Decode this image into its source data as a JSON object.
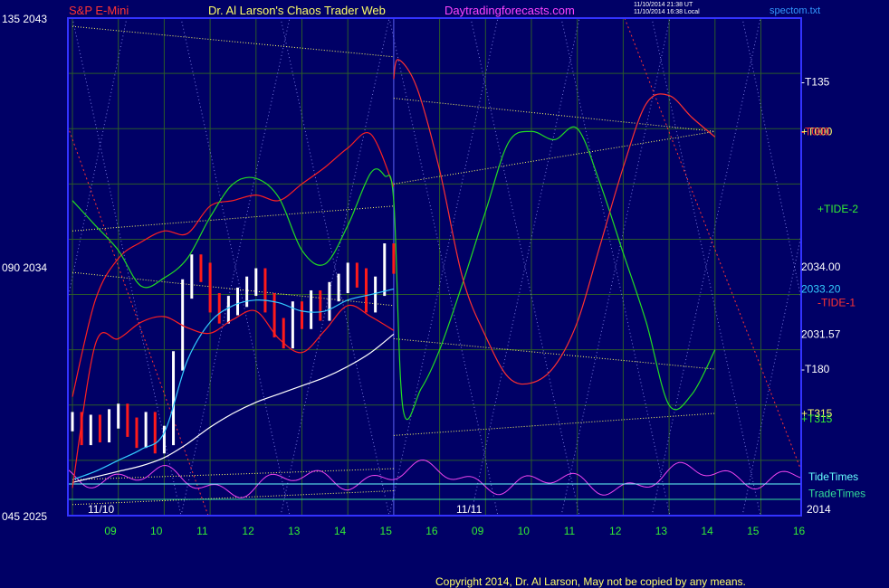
{
  "header": {
    "symbol": "S&P E-Mini",
    "title": "Dr. Al Larson's Chaos Trader Web",
    "site": "Daytradingforecasts.com",
    "time_utc": "11/10/2014 21:38 UT",
    "time_local": "11/10/2014 16:38 Local",
    "filename": "spectom.txt"
  },
  "footer": {
    "copyright": "Copyright 2014, Dr. Al Larson, May not be copied by any means."
  },
  "colors": {
    "background": "#000066",
    "plot_border": "#3333ff",
    "grid": "#2b5a2b",
    "price_up": "#ffffff",
    "price_down": "#ff1a1a",
    "avg_fast": "#33ccff",
    "avg_slow": "#ffffff",
    "band": "#ff2020",
    "tide_plus": "#22dd22",
    "tide_minus": "#ff3030",
    "channel": "#ffff66",
    "tide_times": "#66ffff",
    "trade_times": "#33dd99",
    "oscillator": "#ee44ee",
    "lattice": "#9999ff"
  },
  "chart_data": {
    "type": "line",
    "title": "S&P E-Mini",
    "ylim": [
      2025,
      2043
    ],
    "grid": true,
    "left_axis_labels": [
      {
        "angle": "135",
        "price": "2043"
      },
      {
        "angle": "090",
        "price": "2034"
      },
      {
        "angle": "045",
        "price": "2025"
      }
    ],
    "x_tick_labels": [
      "09",
      "10",
      "11",
      "12",
      "13",
      "14",
      "15",
      "16",
      "09",
      "10",
      "11",
      "12",
      "13",
      "14",
      "15",
      "16"
    ],
    "date_labels": [
      "11/10",
      "11/11"
    ],
    "year_label": "2014",
    "hours_per_day": 7,
    "line_labels": [
      {
        "text": "-T135",
        "price": 2040.7
      },
      {
        "text": "+T000",
        "price": 2038.9
      },
      {
        "text": "-T000",
        "price": 2038.9
      },
      {
        "text": "+TIDE-2",
        "price": 2036.1
      },
      {
        "text": "2034.00",
        "price": 2034.0
      },
      {
        "text": "2033.20",
        "price": 2033.2
      },
      {
        "text": "-TIDE-1",
        "price": 2032.7
      },
      {
        "text": "2031.57",
        "price": 2031.57
      },
      {
        "text": "-T180",
        "price": 2030.3
      },
      {
        "text": "+T315",
        "price": 2028.7
      },
      {
        "text": "+T315",
        "price": 2028.5
      },
      {
        "text": "TideTimes",
        "price": 2026.4
      },
      {
        "text": "TradeTimes",
        "price": 2025.8
      }
    ],
    "series": [
      {
        "name": "Price",
        "kind": "bars",
        "x": [
          0,
          0.2,
          0.4,
          0.6,
          0.8,
          1.0,
          1.2,
          1.4,
          1.6,
          1.8,
          2.0,
          2.2,
          2.4,
          2.6,
          2.8,
          3.0,
          3.2,
          3.4,
          3.6,
          3.8,
          4.0,
          4.2,
          4.4,
          4.6,
          4.8,
          5.0,
          5.2,
          5.4,
          5.6,
          5.8,
          6.0,
          6.2,
          6.4,
          6.6,
          6.8,
          7.0
        ],
        "values": [
          2028.4,
          2027.9,
          2028.3,
          2028.0,
          2028.5,
          2028.7,
          2028.2,
          2027.8,
          2028.4,
          2027.6,
          2027.9,
          2030.6,
          2033.2,
          2034.1,
          2033.8,
          2032.7,
          2032.3,
          2032.6,
          2032.9,
          2033.3,
          2033.6,
          2032.7,
          2031.8,
          2031.4,
          2032.4,
          2032.1,
          2032.8,
          2032.4,
          2033.1,
          2033.4,
          2033.8,
          2033.6,
          2032.7,
          2033.3,
          2034.5,
          2034.1
        ]
      },
      {
        "name": "Fast average",
        "x": [
          0,
          0.5,
          1,
          1.5,
          2,
          2.5,
          3,
          3.5,
          4,
          4.5,
          5,
          5.5,
          6,
          6.5,
          7
        ],
        "values": [
          2026.3,
          2026.6,
          2027.0,
          2027.4,
          2028.0,
          2030.6,
          2032.0,
          2032.6,
          2032.8,
          2032.7,
          2032.4,
          2032.4,
          2032.8,
          2033.0,
          2033.2
        ]
      },
      {
        "name": "Slow average",
        "x": [
          0,
          0.5,
          1,
          1.5,
          2,
          2.5,
          3,
          3.5,
          4,
          4.5,
          5,
          5.5,
          6,
          6.5,
          7
        ],
        "values": [
          2026.2,
          2026.4,
          2026.6,
          2026.8,
          2027.1,
          2027.6,
          2028.2,
          2028.7,
          2029.1,
          2029.4,
          2029.7,
          2030.0,
          2030.4,
          2030.9,
          2031.57
        ]
      },
      {
        "name": "Upper band",
        "x": [
          0,
          0.5,
          1,
          1.5,
          2,
          2.5,
          3,
          3.5,
          4,
          4.5,
          5,
          5.5,
          6,
          6.5,
          7
        ],
        "values": [
          2029.3,
          2032.8,
          2034.3,
          2034.9,
          2035.3,
          2035.2,
          2036.2,
          2036.4,
          2036.6,
          2036.4,
          2037.0,
          2037.6,
          2038.3,
          2038.8,
          2036.9
        ]
      },
      {
        "name": "Lower band",
        "x": [
          0,
          0.5,
          1,
          1.5,
          2,
          2.5,
          3,
          3.5,
          4,
          4.5,
          5,
          5.5,
          6,
          6.5,
          7
        ],
        "values": [
          2026.0,
          2031.2,
          2031.4,
          2032.0,
          2032.2,
          2031.8,
          2031.6,
          2032.1,
          2032.4,
          2031.4,
          2030.9,
          2031.7,
          2032.6,
          2032.2,
          2031.7
        ]
      },
      {
        "name": "+TIDE-2",
        "kind": "forecast",
        "x": [
          0,
          0.5,
          1,
          1.5,
          2,
          2.5,
          3,
          3.5,
          4,
          4.5,
          5,
          5.5,
          6,
          6.5,
          6.8,
          7,
          7.2,
          7.6,
          8,
          8.5,
          9,
          9.5,
          10,
          10.5,
          11,
          11.5,
          12,
          12.5,
          13,
          13.5,
          14
        ],
        "values": [
          2036.4,
          2035.5,
          2034.6,
          2033.3,
          2033.6,
          2034.3,
          2035.8,
          2037.0,
          2037.2,
          2036.5,
          2034.6,
          2034.1,
          2035.5,
          2037.4,
          2037.3,
          2036.4,
          2028.9,
          2029.6,
          2031.0,
          2033.4,
          2036.0,
          2038.5,
          2038.9,
          2038.6,
          2039.0,
          2037.0,
          2034.5,
          2032.0,
          2029.0,
          2029.4,
          2031.0
        ]
      },
      {
        "name": "-TIDE-1",
        "kind": "forecast",
        "x": [
          7,
          7.1,
          7.5,
          8,
          8.5,
          9,
          9.5,
          10,
          10.5,
          11,
          11.5,
          12,
          12.5,
          13,
          13.5,
          14
        ],
        "values": [
          2040.8,
          2041.5,
          2040.5,
          2037.5,
          2033.6,
          2031.5,
          2030.0,
          2029.8,
          2030.4,
          2032.0,
          2034.8,
          2037.6,
          2039.9,
          2040.2,
          2039.4,
          2038.7
        ]
      },
      {
        "name": "Channel upper",
        "kind": "line",
        "x": [
          0,
          7,
          14
        ],
        "values": [
          2042.7,
          2041.6,
          2040.7
        ]
      }
    ]
  }
}
